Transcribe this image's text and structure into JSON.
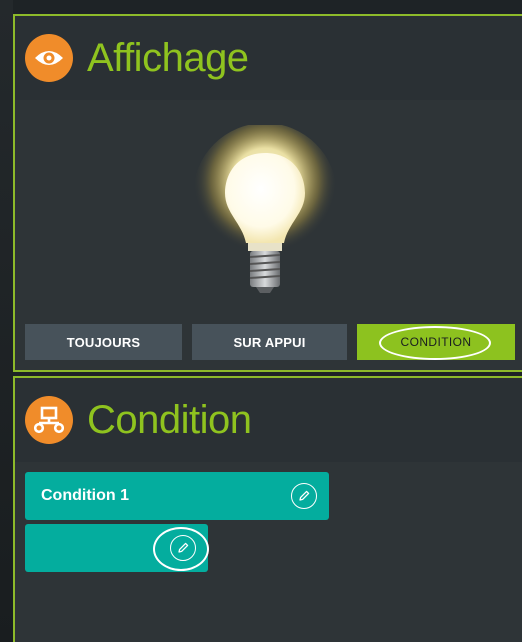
{
  "affichage": {
    "title": "Affichage",
    "icon": "eye-icon",
    "modes": [
      {
        "label": "TOUJOURS",
        "selected": false
      },
      {
        "label": "SUR APPUI",
        "selected": false
      },
      {
        "label": "CONDITION",
        "selected": true
      }
    ]
  },
  "condition": {
    "title": "Condition",
    "icon": "flowchart-icon",
    "items": [
      {
        "label": "Condition 1"
      },
      {
        "label": ""
      }
    ]
  },
  "colors": {
    "accent_green": "#8dc21f",
    "icon_orange": "#f08c2a",
    "teal": "#04ad9e",
    "panel_bg": "#2d3336"
  }
}
